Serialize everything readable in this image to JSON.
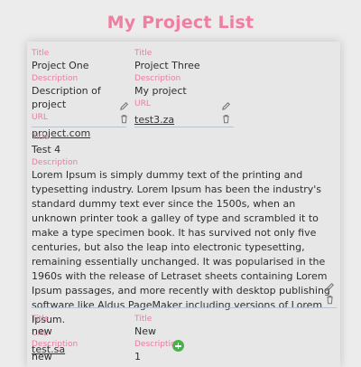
{
  "page": {
    "title": "My Project List"
  },
  "labels": {
    "title": "Title",
    "description": "Description",
    "url": "URL"
  },
  "projects": [
    {
      "title": "Project One",
      "description": "Description of project",
      "url": "project.com"
    },
    {
      "title": "Project Three",
      "description": "My project",
      "url": "test3.za"
    },
    {
      "title": "Test 4",
      "description": "Lorem Ipsum is simply dummy text of the printing and typesetting industry. Lorem Ipsum has been the industry's standard dummy text ever since the 1500s, when an unknown printer took a galley of type and scrambled it to make a type specimen book. It has survived not only five centuries, but also the leap into electronic typesetting, remaining essentially unchanged. It was popularised in the 1960s with the release of Letraset sheets containing Lorem Ipsum passages, and more recently with desktop publishing software like Aldus PageMaker including versions of Lorem Ipsum.",
      "url": "test.sa"
    },
    {
      "title": "new",
      "description": "new"
    },
    {
      "title": "New",
      "description": "1"
    }
  ],
  "icons": {
    "edit": "pencil-icon",
    "delete": "trash-icon",
    "add": "plus-circle-icon"
  },
  "colors": {
    "accent": "#f17ea1",
    "label": "#e57fa0",
    "add": "#4caf50",
    "background": "#ececec"
  }
}
